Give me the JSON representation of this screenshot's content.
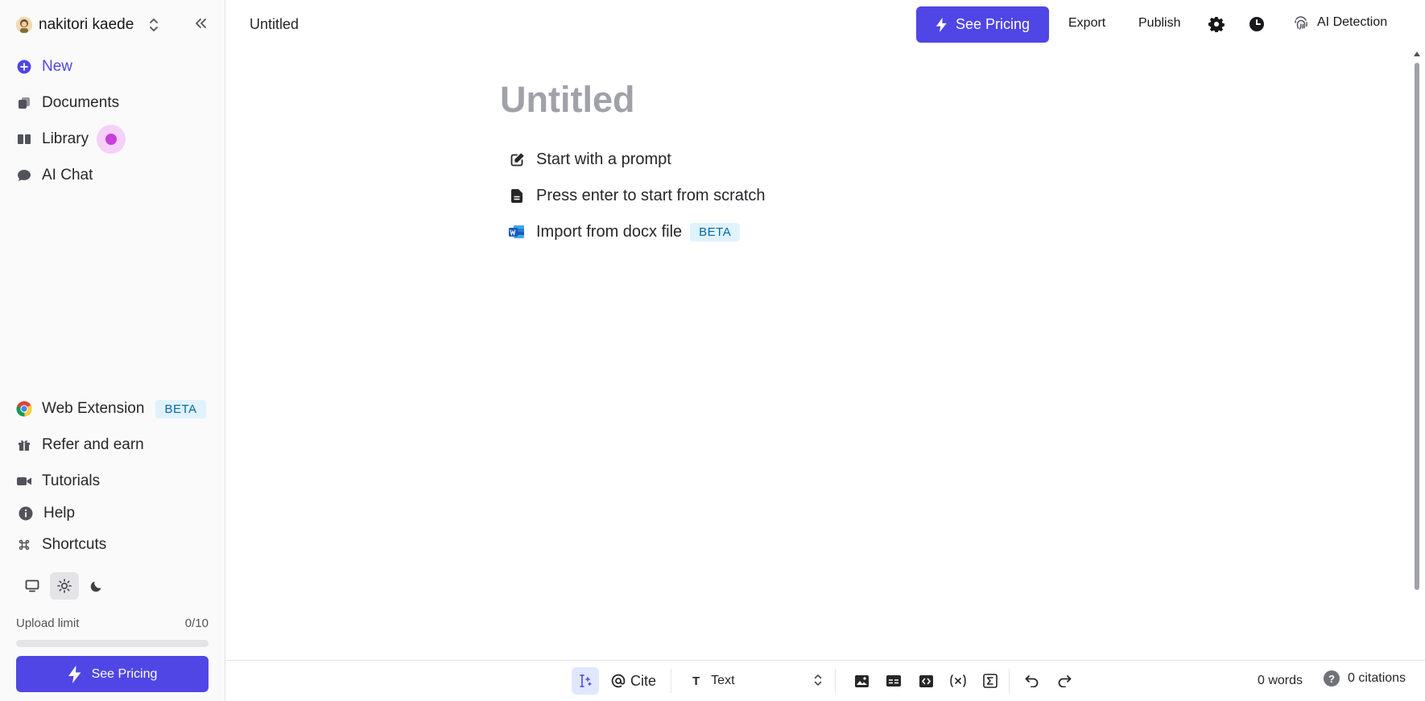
{
  "account": {
    "name": "nakitori kaede"
  },
  "sidebar": {
    "nav": [
      {
        "label": "New",
        "icon": "plus-circle-icon"
      },
      {
        "label": "Documents",
        "icon": "documents-icon"
      },
      {
        "label": "Library",
        "icon": "book-icon"
      },
      {
        "label": "AI Chat",
        "icon": "chat-bubble-icon"
      }
    ],
    "bottom": [
      {
        "label": "Web Extension",
        "icon": "chrome-icon",
        "badge": "BETA"
      },
      {
        "label": "Refer and earn",
        "icon": "gift-icon"
      },
      {
        "label": "Tutorials",
        "icon": "video-icon"
      },
      {
        "label": "Help",
        "icon": "info-icon"
      },
      {
        "label": "Shortcuts",
        "icon": "command-icon"
      }
    ],
    "theme_options": [
      "system",
      "light",
      "dark"
    ],
    "theme_selected": "light",
    "upload": {
      "label": "Upload limit",
      "count": "0/10",
      "progress": 0
    },
    "pricing_label": "See Pricing"
  },
  "topbar": {
    "doc_title": "Untitled",
    "pricing_label": "See Pricing",
    "export_label": "Export",
    "publish_label": "Publish",
    "ai_detection_label": "AI Detection"
  },
  "editor": {
    "title_placeholder": "Untitled",
    "options": [
      {
        "label": "Start with a prompt",
        "icon": "edit-icon"
      },
      {
        "label": "Press enter to start from scratch",
        "icon": "file-icon"
      },
      {
        "label": "Import from docx file",
        "icon": "word-icon",
        "badge": "BETA"
      }
    ]
  },
  "toolbar": {
    "cite_label": "Cite",
    "text_style": "Text",
    "words": "0 words",
    "citations": "0 citations",
    "help_glyph": "?"
  },
  "colors": {
    "accent": "#4f46e5",
    "beta_bg": "#e0f2fe",
    "beta_text": "#0369a1",
    "sidebar_bg": "#fafafa"
  }
}
